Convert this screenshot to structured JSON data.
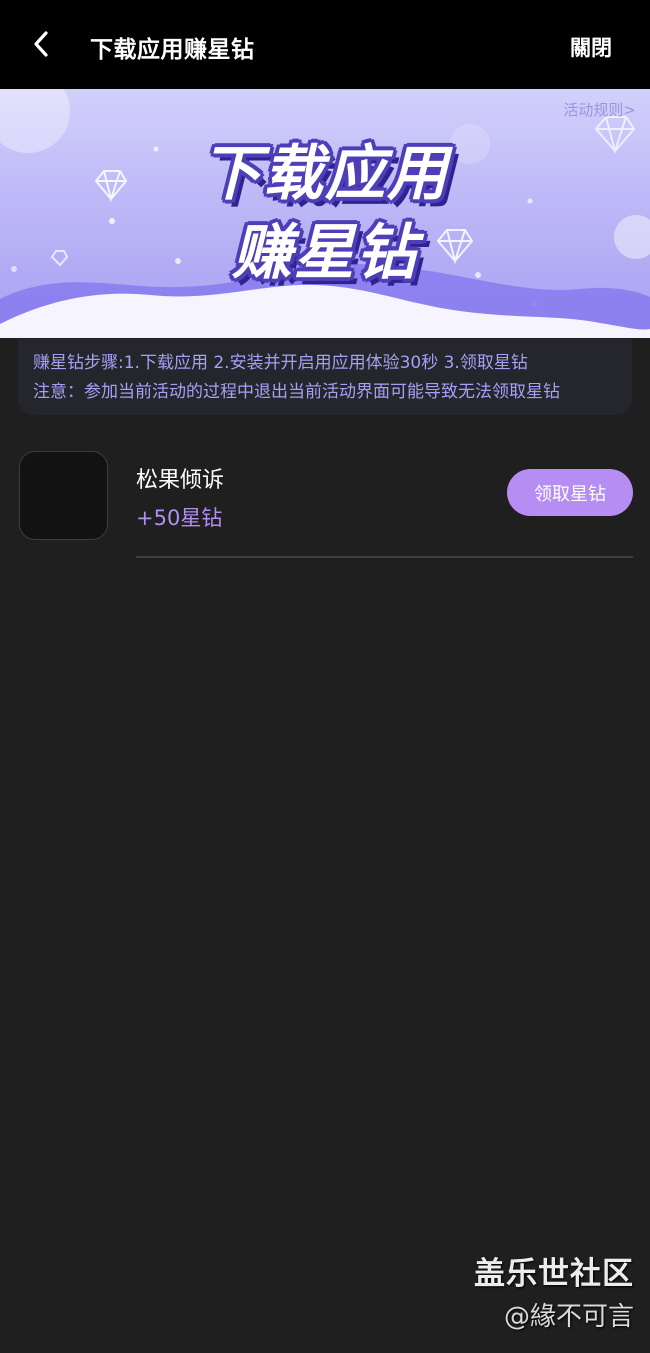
{
  "header": {
    "title": "下载应用赚星钻",
    "close_label": "關閉",
    "back_icon": "chevron-left-icon"
  },
  "banner": {
    "rules_link": "活动规则>",
    "line1": "下载应用",
    "line2": "赚星钻",
    "colors": {
      "bg_top": "#d2d0fb",
      "bg_bottom": "#a79ff1",
      "title_outline": "#4e3fb8"
    }
  },
  "info": {
    "steps": "赚星钻步骤:1.下载应用 2.安装并开启用应用体验30秒 3.领取星钻",
    "notice": "注意：参加当前活动的过程中退出当前活动界面可能导致无法领取星钻"
  },
  "apps": [
    {
      "name": "松果倾诉",
      "reward": "+50星钻",
      "button_label": "领取星钻"
    }
  ],
  "watermark": {
    "title": "盖乐世社区",
    "user": "@緣不可言"
  },
  "colors": {
    "page_bg": "#1f1f1f",
    "accent": "#b58df3",
    "info_text": "#a99ef5"
  }
}
